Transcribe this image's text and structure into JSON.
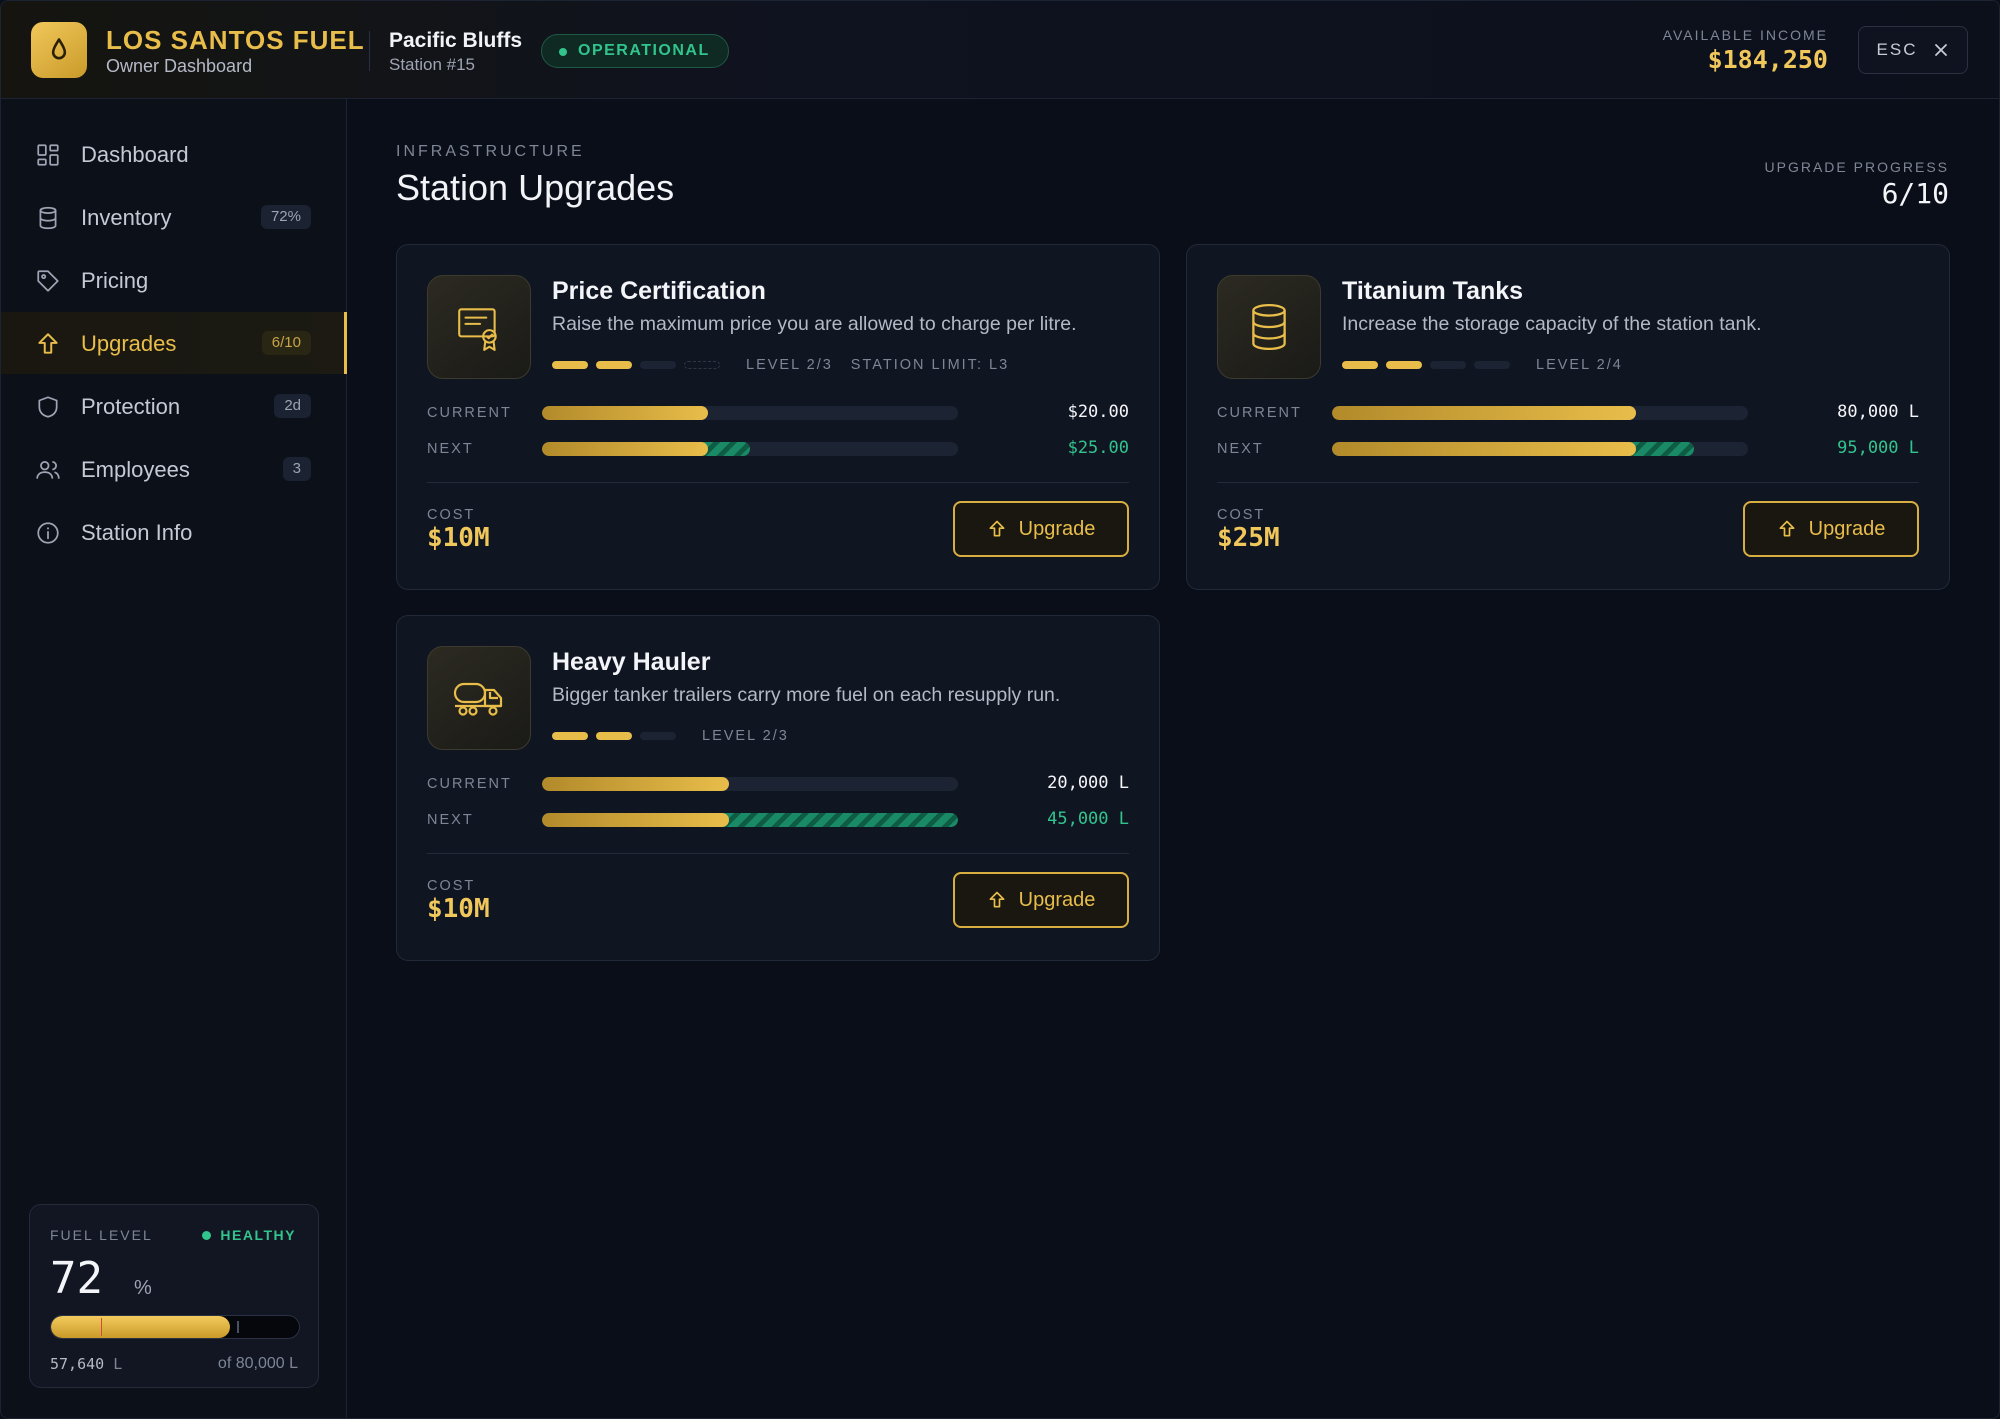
{
  "header": {
    "brand": "LOS SANTOS FUEL",
    "subtitle": "Owner Dashboard",
    "station_name": "Pacific Bluffs",
    "station_number": "Station #15",
    "status": "OPERATIONAL",
    "income_label": "AVAILABLE INCOME",
    "income_value": "$184,250",
    "esc_label": "ESC"
  },
  "sidebar": {
    "items": [
      {
        "label": "Dashboard",
        "icon": "dashboard-icon",
        "badge": ""
      },
      {
        "label": "Inventory",
        "icon": "database-icon",
        "badge": "72%"
      },
      {
        "label": "Pricing",
        "icon": "tag-icon",
        "badge": ""
      },
      {
        "label": "Upgrades",
        "icon": "arrow-up-icon",
        "badge": "6/10",
        "active": true
      },
      {
        "label": "Protection",
        "icon": "shield-icon",
        "badge": "2d"
      },
      {
        "label": "Employees",
        "icon": "users-icon",
        "badge": "3"
      },
      {
        "label": "Station Info",
        "icon": "info-icon",
        "badge": ""
      }
    ],
    "fuel": {
      "label": "FUEL LEVEL",
      "status": "HEALTHY",
      "percent": "72",
      "percent_unit": "%",
      "fill_fraction": 0.72,
      "liters": "57,640",
      "liters_unit": "L",
      "capacity": "of 80,000 L"
    }
  },
  "main": {
    "section_label": "INFRASTRUCTURE",
    "title": "Station Upgrades",
    "progress_label": "UPGRADE PROGRESS",
    "progress_value": "6/10",
    "cards": [
      {
        "title": "Price Certification",
        "description": "Raise the maximum price you are allowed to charge per litre.",
        "icon": "certificate-icon",
        "level_text": "LEVEL 2/3",
        "limit_text": "STATION LIMIT: L3",
        "pips": [
          "on",
          "on",
          "off",
          "locked"
        ],
        "current_label": "CURRENT",
        "next_label": "NEXT",
        "current_value": "$20.00",
        "next_value": "$25.00",
        "current_fraction": 0.4,
        "next_fraction": 0.5,
        "cost_label": "COST",
        "cost_value": "$10M",
        "button_label": "Upgrade"
      },
      {
        "title": "Titanium Tanks",
        "description": "Increase the storage capacity of the station tank.",
        "icon": "database-icon",
        "level_text": "LEVEL 2/4",
        "limit_text": "",
        "pips": [
          "on",
          "on",
          "off",
          "off"
        ],
        "current_label": "CURRENT",
        "next_label": "NEXT",
        "current_value": "80,000 L",
        "next_value": "95,000 L",
        "current_fraction": 0.73,
        "next_fraction": 0.87,
        "cost_label": "COST",
        "cost_value": "$25M",
        "button_label": "Upgrade"
      },
      {
        "title": "Heavy Hauler",
        "description": "Bigger tanker trailers carry more fuel on each resupply run.",
        "icon": "tanker-truck-icon",
        "level_text": "LEVEL 2/3",
        "limit_text": "",
        "pips": [
          "on",
          "on",
          "off"
        ],
        "current_label": "CURRENT",
        "next_label": "NEXT",
        "current_value": "20,000 L",
        "next_value": "45,000 L",
        "current_fraction": 0.45,
        "next_fraction": 1.0,
        "cost_label": "COST",
        "cost_value": "$10M",
        "button_label": "Upgrade"
      }
    ]
  }
}
